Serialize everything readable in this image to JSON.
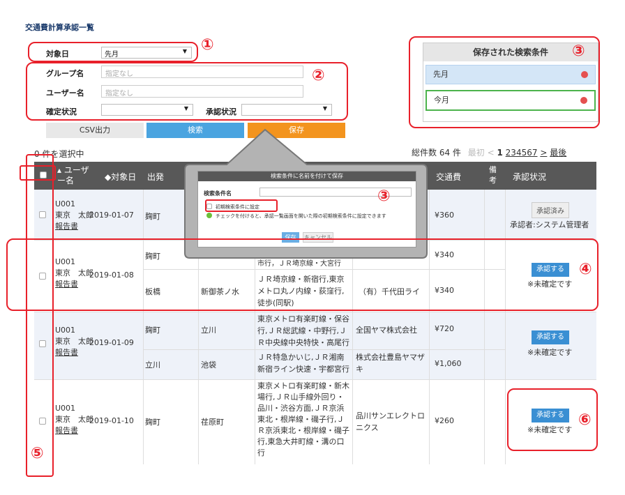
{
  "page": {
    "title": "交通費計算承認一覧"
  },
  "filters": {
    "target_date_label": "対象日",
    "target_date_value": "先月",
    "group_label": "グループ名",
    "group_placeholder": "指定なし",
    "user_label": "ユーザー名",
    "user_placeholder": "指定なし",
    "confirm_label": "確定状況",
    "confirm_value": "",
    "approve_label": "承認状況",
    "approve_value": ""
  },
  "buttons": {
    "csv": "CSV出力",
    "search": "検索",
    "save": "保存"
  },
  "saved": {
    "title": "保存された検索条件",
    "items": [
      "先月",
      "今月"
    ]
  },
  "callouts": [
    "①",
    "②",
    "③",
    "③",
    "④",
    "⑤",
    "⑥"
  ],
  "selection": "0 件を選択中",
  "pagination": {
    "total": "総件数 64 件",
    "first": "最初",
    "prev": "<",
    "pages": [
      "1",
      "2",
      "3",
      "4",
      "5",
      "6",
      "7"
    ],
    "next": ">",
    "last": "最後"
  },
  "table": {
    "headers": [
      "ユーザー名",
      "対象日",
      "出発",
      "",
      "",
      "",
      "交通費",
      "備考",
      "承認状況"
    ]
  },
  "rows": [
    {
      "user_id": "U001",
      "user_name": "東京　太郎",
      "report": "報告書",
      "date": "2019-01-07",
      "segments": [
        {
          "from": "麹町",
          "to": "",
          "route": "",
          "company": "",
          "fare": "¥360"
        }
      ],
      "status_label": "承認済み",
      "status_note": "承認者:システム管理者"
    },
    {
      "user_id": "U001",
      "user_name": "東京　太郎",
      "report": "報告書",
      "date": "2019-01-08",
      "segments": [
        {
          "from": "麹町",
          "to": "",
          "route": "市行，ＪＲ埼京線・大宮行",
          "company": "",
          "fare": "¥340"
        },
        {
          "from": "板橋",
          "to": "新御茶ノ水",
          "route": "ＪＲ埼京線・新宿行,東京メトロ丸ノ内線・荻窪行,徒歩(同駅)",
          "company": "（有）千代田ライ",
          "fare": "¥340"
        }
      ],
      "button": "承認する",
      "status_note": "※未確定です"
    },
    {
      "user_id": "U001",
      "user_name": "東京　太郎",
      "report": "報告書",
      "date": "2019-01-09",
      "segments": [
        {
          "from": "麹町",
          "to": "立川",
          "route": "東京メトロ有楽町線・保谷行,ＪＲ総武線・中野行,ＪＲ中央線中央特快・高尾行",
          "company": "全国ヤマ株式会社",
          "fare": "¥720"
        },
        {
          "from": "立川",
          "to": "池袋",
          "route": "ＪＲ特急かいじ,ＪＲ湘南新宿ライン快速・宇都宮行",
          "company": "株式会社豊島ヤマザキ",
          "fare": "¥1,060"
        }
      ],
      "button": "承認する",
      "status_note": "※未確定です"
    },
    {
      "user_id": "U001",
      "user_name": "東京　太郎",
      "report": "報告書",
      "date": "2019-01-10",
      "segments": [
        {
          "from": "麹町",
          "to": "荏原町",
          "route": "東京メトロ有楽町線・新木場行,ＪＲ山手線外回り・品川・渋谷方面,ＪＲ京浜東北・根岸線・磯子行,ＪＲ京浜東北・根岸線・磯子行,東急大井町線・溝の口行",
          "company": "品川サンエレクトロニクス",
          "fare": "¥260"
        }
      ],
      "button": "承認する",
      "status_note": "※未確定です"
    }
  ],
  "modal": {
    "title": "検索条件に名前を付けて保存",
    "name_label": "検索条件名",
    "default_label": "初期検索条件に設定",
    "hint": "チェックを付けると、承認一覧画面を開いた際の初期検索条件に設定できます",
    "save": "保存",
    "cancel": "キャンセル"
  }
}
